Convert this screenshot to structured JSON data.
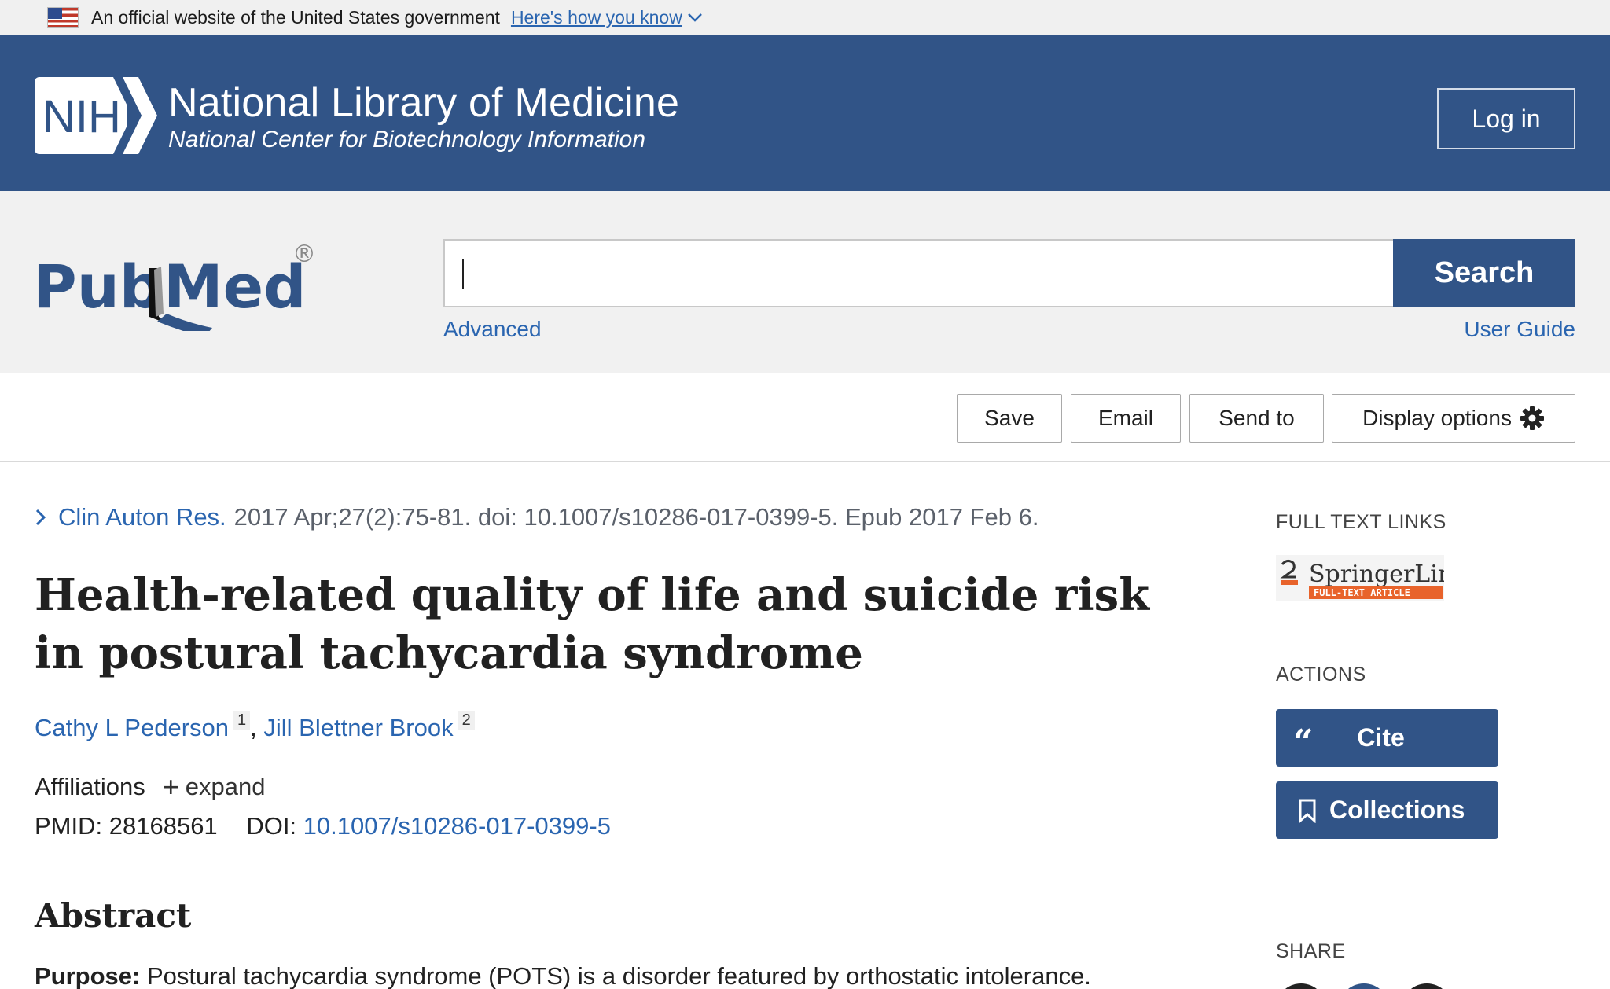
{
  "gov_banner": {
    "text": "An official website of the United States government",
    "link": "Here's how you know"
  },
  "header": {
    "logo_text": "NIH",
    "title": "National Library of Medicine",
    "subtitle": "National Center for Biotechnology Information",
    "login_label": "Log in"
  },
  "search": {
    "logo_text_left": "Pub",
    "logo_text_right": "Med",
    "logo_mark": "®",
    "placeholder": "",
    "button_label": "Search",
    "advanced_label": "Advanced",
    "user_guide_label": "User Guide"
  },
  "toolbar": {
    "save_label": "Save",
    "email_label": "Email",
    "send_to_label": "Send to",
    "display_options_label": "Display options"
  },
  "article": {
    "journal": "Clin Auton Res.",
    "citation": "2017 Apr;27(2):75-81. doi: 10.1007/s10286-017-0399-5. Epub 2017 Feb 6.",
    "title": "Health-related quality of life and suicide risk in postural tachycardia syndrome",
    "authors": [
      {
        "name": "Cathy L Pederson",
        "affil": "1"
      },
      {
        "name": "Jill Blettner Brook",
        "affil": "2"
      }
    ],
    "author_separator": ",",
    "affiliations_label": "Affiliations",
    "expand_label": "expand",
    "pmid_label": "PMID:",
    "pmid": "28168561",
    "doi_label": "DOI:",
    "doi": "10.1007/s10286-017-0399-5",
    "abstract_heading": "Abstract",
    "purpose_label": "Purpose:",
    "purpose_text": "Postural tachycardia syndrome (POTS) is a disorder featured by orthostatic intolerance."
  },
  "sidebar": {
    "full_text_heading": "FULL TEXT LINKS",
    "springer_name": "SpringerLink",
    "springer_tag": "FULL-TEXT ARTICLE",
    "actions_heading": "ACTIONS",
    "cite_label": "Cite",
    "collections_label": "Collections",
    "share_heading": "SHARE"
  },
  "colors": {
    "brand_blue": "#315487",
    "link_blue": "#2a65b0",
    "springer_orange": "#e8632b"
  }
}
